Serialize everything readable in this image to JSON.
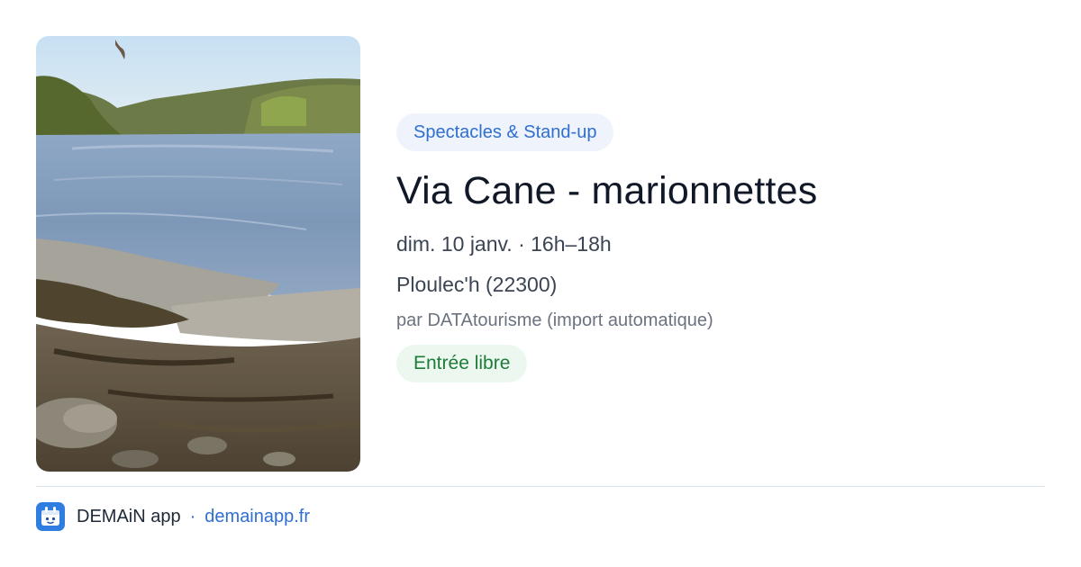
{
  "event": {
    "category": "Spectacles & Stand-up",
    "title": "Via Cane - marionnettes",
    "datetime": "dim. 10 janv. · 16h–18h",
    "location": "Ploulec'h (22300)",
    "source": "par DATAtourisme (import automatique)",
    "price": "Entrée libre"
  },
  "footer": {
    "app_name": "DEMAiN app",
    "separator": "·",
    "url": "demainapp.fr"
  },
  "colors": {
    "accent": "#2f6fcf",
    "category_bg": "#eef3fc",
    "price_bg": "#ecf8ef",
    "price_text": "#1e7b3a",
    "title": "#111827"
  },
  "icons": {
    "app": "demain-app-icon"
  }
}
